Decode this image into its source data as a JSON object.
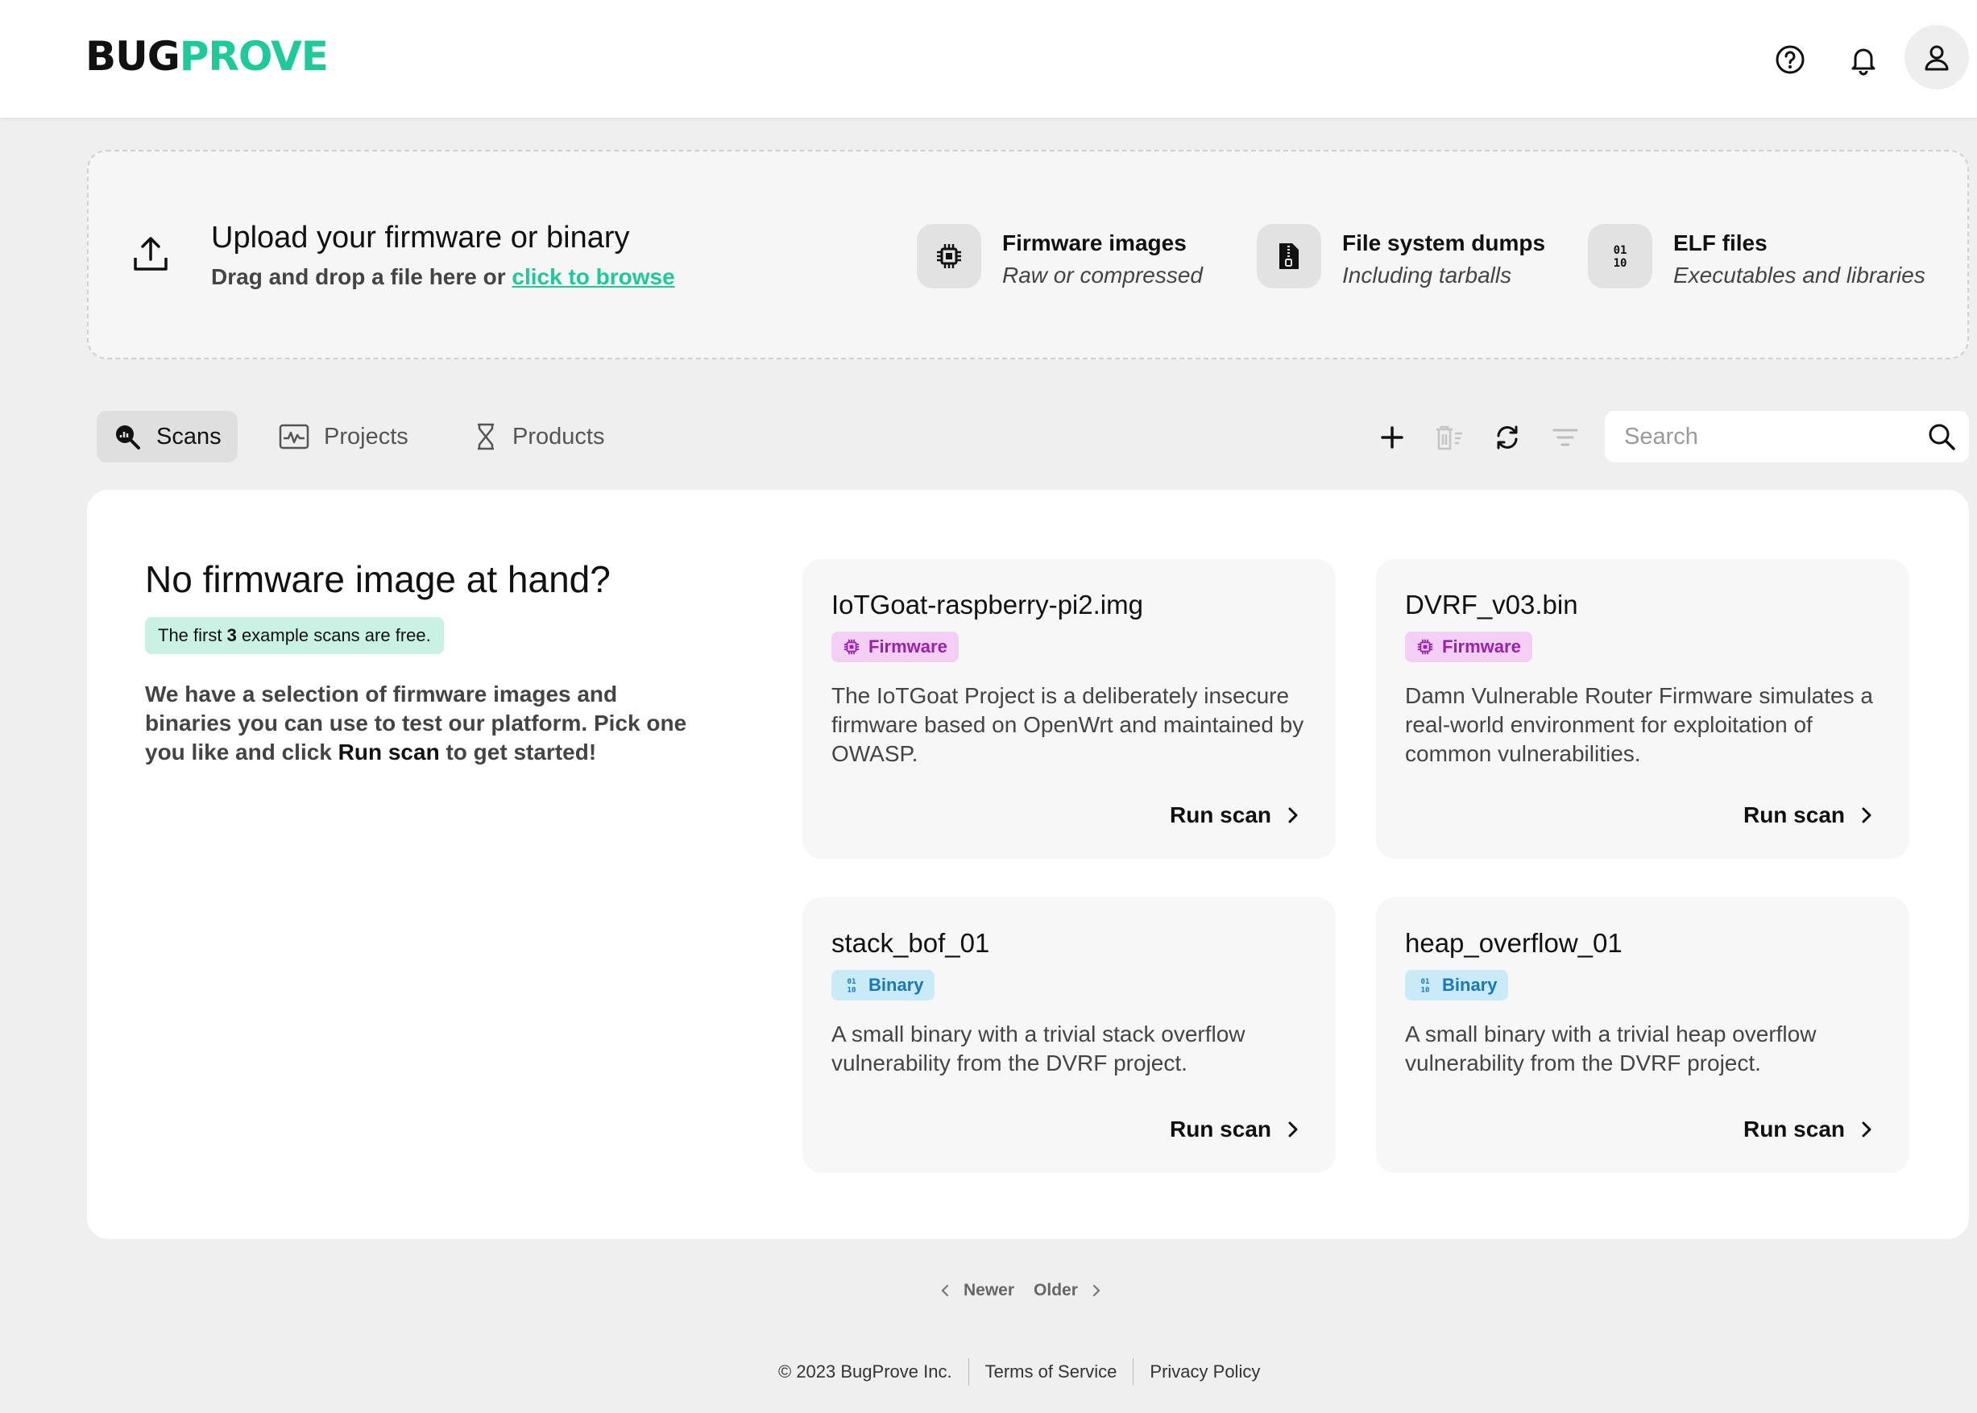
{
  "header": {
    "logo_part1": "BUG",
    "logo_part2": "PROVE",
    "icons": [
      "help-icon",
      "bell-icon",
      "user-icon"
    ]
  },
  "upload": {
    "title": "Upload your firmware or binary",
    "subtitle_prefix": "Drag and drop a file here or ",
    "browse_link": "click to browse",
    "file_types": [
      {
        "icon": "chip-icon",
        "title": "Firmware images",
        "subtitle": "Raw or compressed"
      },
      {
        "icon": "zip-file-icon",
        "title": "File system dumps",
        "subtitle": "Including tarballs"
      },
      {
        "icon": "binary-icon",
        "title": "ELF files",
        "subtitle": "Executables and libraries"
      }
    ]
  },
  "tabs": [
    {
      "label": "Scans",
      "icon": "scan-search-icon",
      "active": true
    },
    {
      "label": "Projects",
      "icon": "activity-icon",
      "active": false
    },
    {
      "label": "Products",
      "icon": "hourglass-icon",
      "active": false
    }
  ],
  "toolbar": {
    "icons": [
      "plus-icon",
      "delete-icon",
      "refresh-icon",
      "filter-icon"
    ],
    "search_placeholder": "Search"
  },
  "intro": {
    "title": "No firmware image at hand?",
    "badge_prefix": "The first ",
    "badge_count": "3",
    "badge_suffix": " example scans are free.",
    "text_part1": "We have a selection of firmware images and binaries you can use to test our platform. Pick one you like and click ",
    "text_bold": "Run scan",
    "text_part2": " to get started!"
  },
  "examples": [
    {
      "name": "IoTGoat-raspberry-pi2.img",
      "type": "Firmware",
      "description": "The IoTGoat Project is a deliberately insecure firmware based on OpenWrt and maintained by OWASP.",
      "action": "Run scan"
    },
    {
      "name": "DVRF_v03.bin",
      "type": "Firmware",
      "description": "Damn Vulnerable Router Firmware simulates a real-world environment for exploitation of common vulnerabilities.",
      "action": "Run scan"
    },
    {
      "name": "stack_bof_01",
      "type": "Binary",
      "description": "A small binary with a trivial stack overflow vulnerability from the DVRF project.",
      "action": "Run scan"
    },
    {
      "name": "heap_overflow_01",
      "type": "Binary",
      "description": "A small binary with a trivial heap overflow vulnerability from the DVRF project.",
      "action": "Run scan"
    }
  ],
  "pagination": {
    "newer": "Newer",
    "older": "Older"
  },
  "footer": {
    "copyright": "© 2023 BugProve Inc.",
    "terms": "Terms of Service",
    "privacy": "Privacy Policy"
  },
  "colors": {
    "brand": "#1ec99a",
    "firmware_badge_bg": "#f2cff3",
    "firmware_badge_fg": "#9b1fb0",
    "binary_badge_bg": "#c9ebf8",
    "binary_badge_fg": "#1878b8"
  }
}
